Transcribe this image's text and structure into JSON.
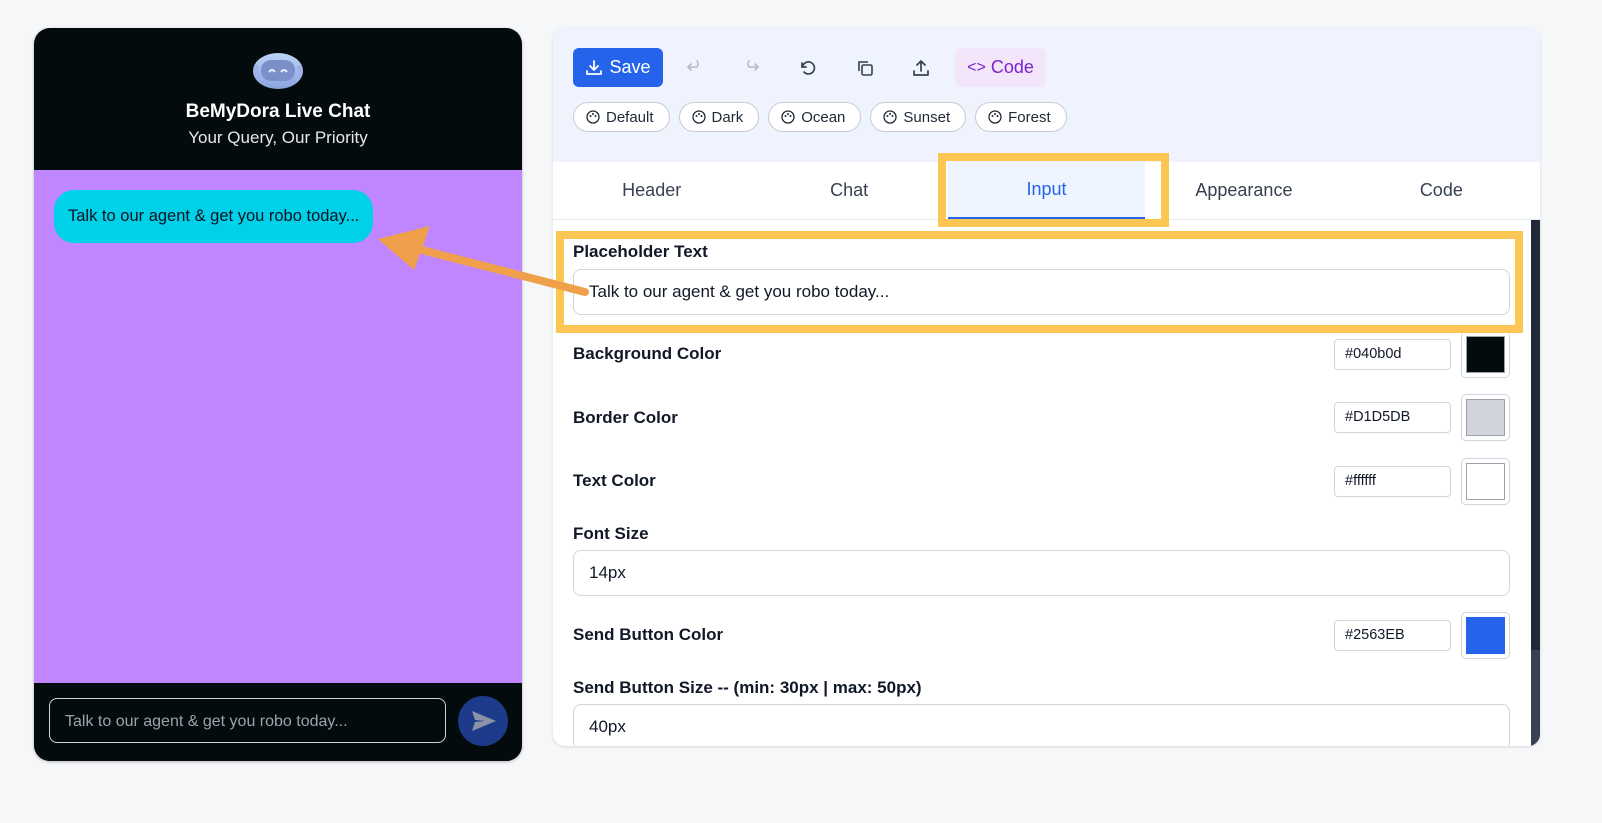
{
  "widget": {
    "title": "BeMyDora Live Chat",
    "subtitle": "Your Query, Our Priority",
    "bubble_text": "Talk to our agent & get you robo today...",
    "input_placeholder": "Talk to our agent & get you robo today...",
    "avatar_icon": "robot-icon",
    "send_icon": "send-icon"
  },
  "toolbar": {
    "save_label": "Save",
    "code_label": "Code",
    "tools": [
      "undo-icon",
      "redo-icon",
      "reset-icon",
      "copy-icon",
      "export-icon"
    ],
    "themes": [
      "Default",
      "Dark",
      "Ocean",
      "Sunset",
      "Forest"
    ]
  },
  "tabs": [
    "Header",
    "Chat",
    "Input",
    "Appearance",
    "Code"
  ],
  "active_tab": "Input",
  "fields": {
    "placeholder": {
      "label": "Placeholder Text",
      "value": "Talk to our agent & get you robo today..."
    },
    "background": {
      "label": "Background Color",
      "value": "#040b0d",
      "color": "#040b0d"
    },
    "border": {
      "label": "Border Color",
      "value": "#D1D5DB",
      "color": "#D1D5DB"
    },
    "text": {
      "label": "Text Color",
      "value": "#ffffff",
      "color": "#ffffff"
    },
    "font_size": {
      "label": "Font Size",
      "value": "14px"
    },
    "send_color": {
      "label": "Send Button Color",
      "value": "#2563EB",
      "color": "#2563EB"
    },
    "send_size": {
      "label": "Send Button Size -- (min: 30px | max: 50px)",
      "value": "40px"
    }
  },
  "colors": {
    "widget_body": "#bf86ff",
    "bubble": "#00d0e8",
    "accent": "#2563eb",
    "highlight": "#fcc655",
    "arrow": "#f0a04b"
  }
}
